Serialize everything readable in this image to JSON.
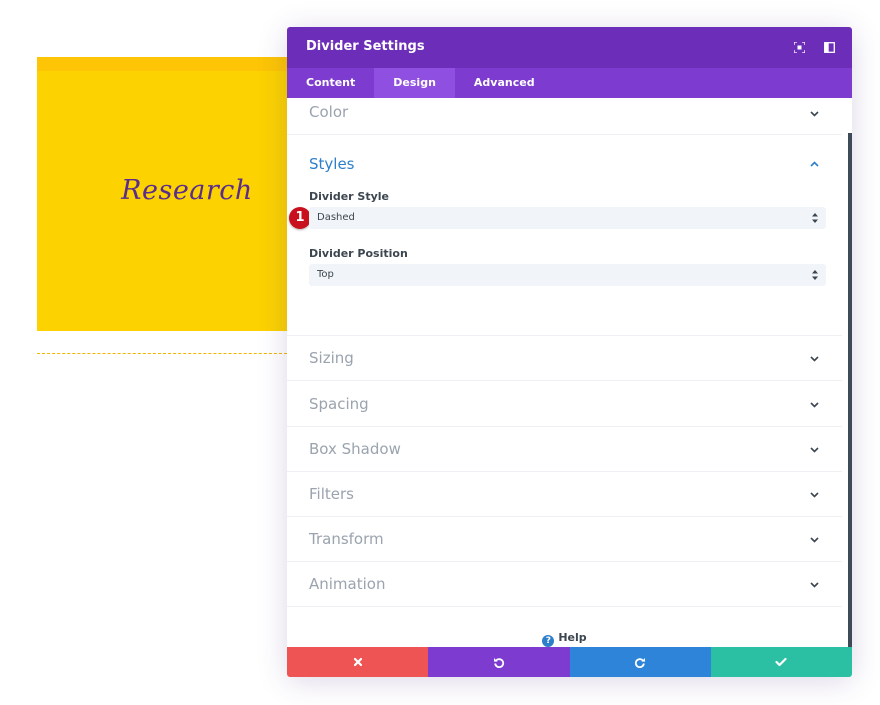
{
  "preview": {
    "heading": "Research",
    "card_color": "#fcd200",
    "text_color": "#5a2d8c",
    "divider_color": "#f2b400"
  },
  "modal": {
    "title": "Divider Settings",
    "header_color": "#6c2eb9",
    "tab_bar_color": "#7e3bd0",
    "icons": [
      "fullscreen-icon",
      "sidebar-layout-icon"
    ]
  },
  "tabs": [
    {
      "label": "Content",
      "active": false
    },
    {
      "label": "Design",
      "active": true
    },
    {
      "label": "Advanced",
      "active": false
    }
  ],
  "sections": {
    "color": {
      "title": "Color",
      "expanded": false
    },
    "styles": {
      "title": "Styles",
      "expanded": true,
      "divider_style": {
        "label": "Divider Style",
        "value": "Dashed",
        "marker": "1"
      },
      "divider_position": {
        "label": "Divider Position",
        "value": "Top"
      }
    },
    "sizing": {
      "title": "Sizing"
    },
    "spacing": {
      "title": "Spacing"
    },
    "box_shadow": {
      "title": "Box Shadow"
    },
    "filters": {
      "title": "Filters"
    },
    "transform": {
      "title": "Transform"
    },
    "animation": {
      "title": "Animation"
    }
  },
  "help": {
    "label": "Help"
  },
  "footer": {
    "cancel_color": "#ef5454",
    "undo_color": "#7e3bd0",
    "redo_color": "#2e84d8",
    "save_color": "#2bc0a4",
    "icons": [
      "close-icon",
      "undo-icon",
      "redo-icon",
      "checkmark-icon"
    ]
  }
}
